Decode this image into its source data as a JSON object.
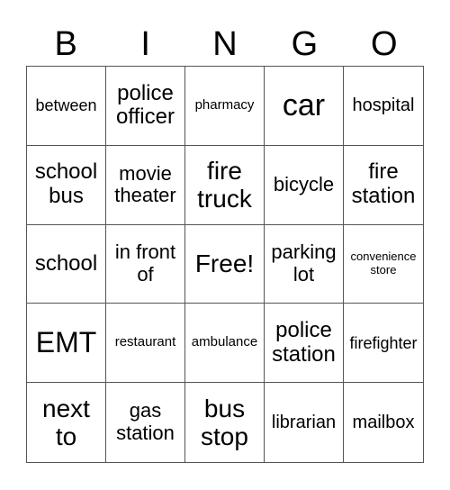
{
  "title_letters": [
    "B",
    "I",
    "N",
    "G",
    "O"
  ],
  "cells": [
    "between",
    "police officer",
    "pharmacy",
    "car",
    "hospital",
    "school bus",
    "movie theater",
    "fire truck",
    "bicycle",
    "fire station",
    "school",
    "in front of",
    "Free!",
    "parking lot",
    "convenience store",
    "EMT",
    "restaurant",
    "ambulance",
    "police station",
    "firefighter",
    "next to",
    "gas station",
    "bus stop",
    "librarian",
    "mailbox"
  ]
}
